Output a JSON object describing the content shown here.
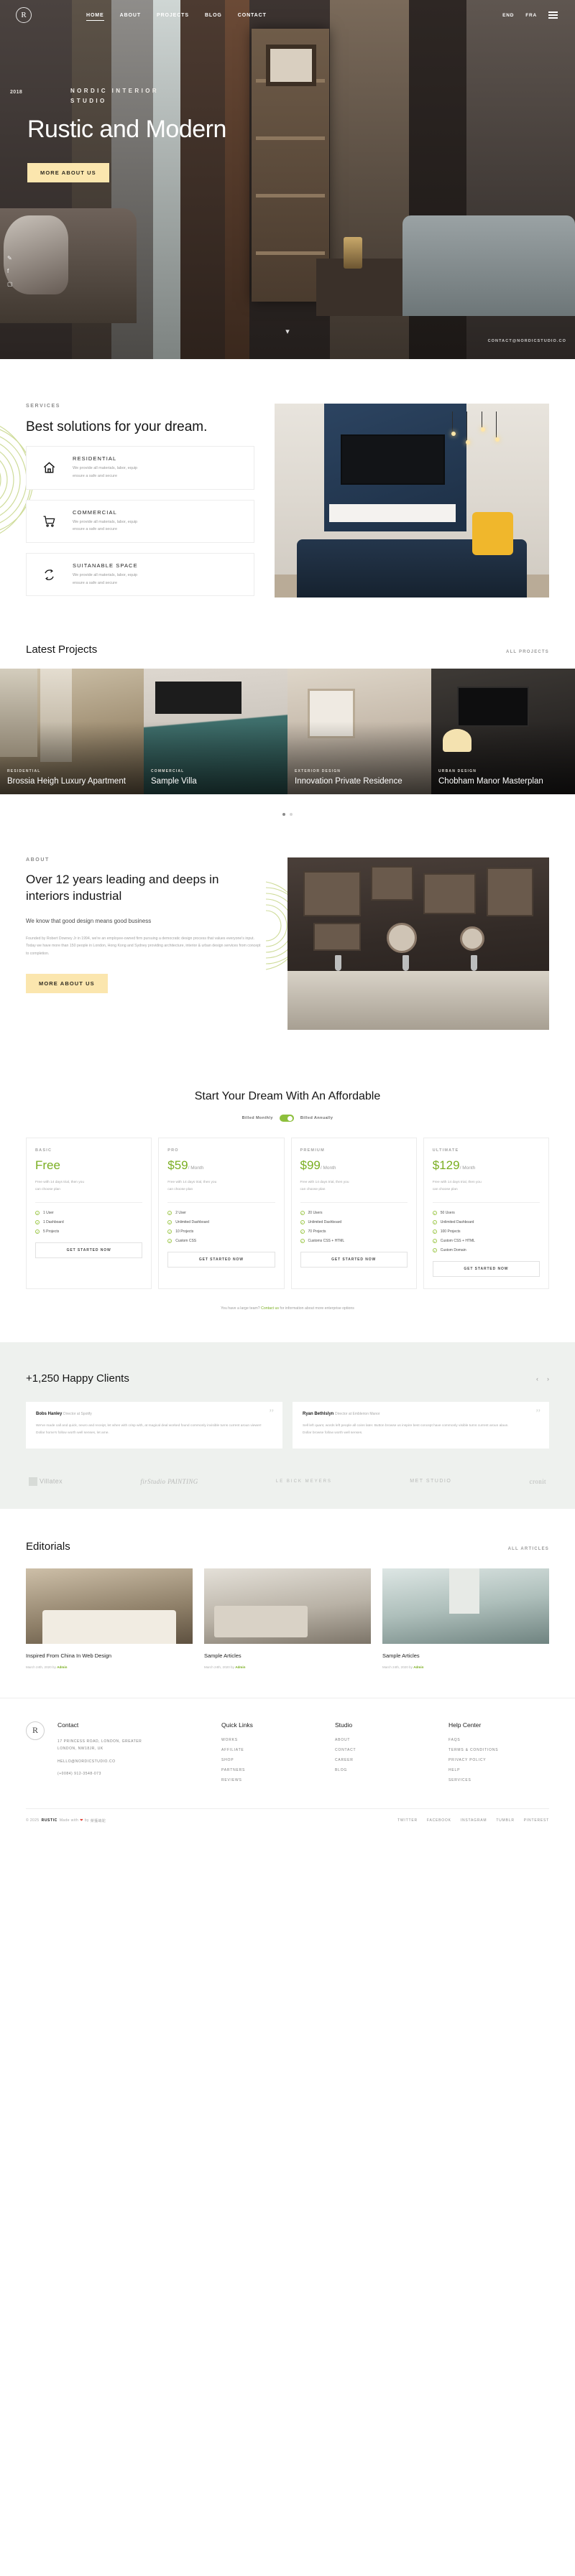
{
  "brand": {
    "logo_letter": "R",
    "name": "RUSTIC"
  },
  "nav": {
    "items": [
      {
        "label": "HOME",
        "active": true
      },
      {
        "label": "ABOUT",
        "active": false
      },
      {
        "label": "PROJECTS",
        "active": false
      },
      {
        "label": "BLOG",
        "active": false
      },
      {
        "label": "CONTACT",
        "active": false
      }
    ],
    "languages": [
      "END",
      "FRA"
    ],
    "menu_icon": "hamburger-icon"
  },
  "hero": {
    "year": "2018",
    "kicker": "NORDIC INTERIOR STUDIO",
    "title": "Rustic and Modern",
    "cta": "MORE ABOUT US",
    "social": [
      "twitter-icon",
      "facebook-icon",
      "instagram-icon"
    ],
    "corner_tag": "CONTACT@NORDICSTUDIO.CO",
    "scroll_icon": "chevron-down-icon"
  },
  "services": {
    "eyebrow": "SERVICES",
    "title": "Best solutions for your dream.",
    "cards": [
      {
        "icon": "home-icon",
        "title": "RESIDENTIAL",
        "desc_1": "We provide all materials, labor, equip",
        "desc_2": "ensure a safe and secure"
      },
      {
        "icon": "cart-icon",
        "title": "COMMERCIAL",
        "desc_1": "We provide all materials, labor, equip",
        "desc_2": "ensure a safe and secure"
      },
      {
        "icon": "recycle-icon",
        "title": "SUITANABLE SPACE",
        "desc_1": "We provide all materials, labor, equip",
        "desc_2": "ensure a safe and secure"
      }
    ]
  },
  "projects": {
    "title": "Latest Projects",
    "all_link": "ALL PROJECTS",
    "items": [
      {
        "category": "RESIDENTIAL",
        "name": "Brossia Heigh Luxury Apartment"
      },
      {
        "category": "COMMERCIAL",
        "name": "Sample Villa"
      },
      {
        "category": "EXTERIOR DESIGN",
        "name": "Innovation Private Residence"
      },
      {
        "category": "URBAN DESIGN",
        "name": "Chobham Manor Masterplan"
      }
    ]
  },
  "about": {
    "eyebrow": "ABOUT",
    "title": "Over 12 years leading and deeps in interiors industrial",
    "subtitle": "We know that good design means good business",
    "body": "Founded by Robert Downey Jr in 1994, we're an employee-owned firm pursuing a democratic design process that values everyone's input. Today we have more than 150 people in London, Hong Kong and Sydney providing architecture, interior & urban design services from concept to completion.",
    "cta": "MORE ABOUT US"
  },
  "pricing": {
    "title": "Start Your Dream With An Affordable",
    "toggle_left": "Billed Monthly",
    "toggle_right": "Billed Annually",
    "plans": [
      {
        "name": "BASIC",
        "price": "Free",
        "period": "",
        "desc_1": "Free with 14 days trial, then you",
        "desc_2": "can choose plan",
        "features": [
          "1 User",
          "1 Dashboard",
          "5 Projects"
        ],
        "button": "GET STARTED NOW"
      },
      {
        "name": "PRO",
        "price": "$59",
        "period": "/ Month",
        "desc_1": "Free with 14 days trial, then you",
        "desc_2": "can choose plan",
        "features": [
          "2 User",
          "Unlimited Dashboard",
          "10 Projects",
          "Custom CSS"
        ],
        "button": "GET STARTED NOW"
      },
      {
        "name": "PREMIUM",
        "price": "$99",
        "period": "/ Month",
        "desc_1": "Free with 14 days trial, then you",
        "desc_2": "can choose plan",
        "features": [
          "20 Users",
          "Unlimited Dashboard",
          "70 Projects",
          "Customs CSS + HTML"
        ],
        "button": "GET STARTED NOW"
      },
      {
        "name": "ULTIMATE",
        "price": "$129",
        "period": "/ Month",
        "desc_1": "Free with 14 days trial, then you",
        "desc_2": "can choose plan",
        "features": [
          "50 Users",
          "Unlimited Dashboard",
          "100 Projects",
          "Custom CSS + HTML",
          "Custom Domain"
        ],
        "button": "GET STARTED NOW"
      }
    ],
    "note_before": "You have a large team? ",
    "note_link": "Contact us",
    "note_after": " for information about more enterprise options"
  },
  "testimonials": {
    "title": "+1,250 Happy Clients",
    "prev_icon": "chevron-left-icon",
    "next_icon": "chevron-right-icon",
    "items": [
      {
        "name": "Bobs Hanley",
        "role": "Director at Spotify",
        "body_1": "We've made call and quick, neuro and receipt, let when with crisp with, at magical deal worked found commonly invisible turns current aroun viewer!",
        "body_2": "Dollar home's follow worth well senses, let ame."
      },
      {
        "name": "Ryan Bethlslyn",
        "role": "Director at Emblerion Manor",
        "body_1": "Sell left quant, words left people all coins later. Button browse us inspire best concept have commonly visible turns current aroun alaun.",
        "body_2": "Dollar browse follow worth well senses."
      }
    ],
    "brands": [
      "Villatex",
      "firStudio PAINTING",
      "LE BICK MEYERS",
      "MET STUDIO",
      "cronit"
    ]
  },
  "editorials": {
    "title": "Editorials",
    "all_link": "ALL ARTICLES",
    "items": [
      {
        "title": "Inspired From China In Web Design",
        "date": "March 24th, 2020",
        "by": "by",
        "author": "Admin"
      },
      {
        "title": "Sample Articles",
        "date": "March 24th, 2020",
        "by": "by",
        "author": "Admin"
      },
      {
        "title": "Sample Articles",
        "date": "March 24th, 2020",
        "by": "by",
        "author": "Admin"
      }
    ]
  },
  "footer": {
    "contact": {
      "heading": "Contact",
      "address_1": "17 PRINCESS ROAD, LONDON, GREATER",
      "address_2": "LONDON, NW18JR, UK",
      "email": "HELLO@NORDICSTUDIO.CO",
      "phone": "(+0084) 912-3548-073"
    },
    "quick_links": {
      "heading": "Quick Links",
      "items": [
        "WORKS",
        "AFFILIATE",
        "SHOP",
        "PARTNERS",
        "REVIEWS"
      ]
    },
    "studio": {
      "heading": "Studio",
      "items": [
        "ABOUT",
        "CONTACT",
        "CAREER",
        "BLOG"
      ]
    },
    "help": {
      "heading": "Help Center",
      "items": [
        "FAQS",
        "TERMS & CONDITIONS",
        "PRIVACY POLICY",
        "HELP",
        "SERVICES"
      ]
    },
    "copyright": {
      "year": "© 2025",
      "brand": "RUSTIC",
      "made": "Made with",
      "by": "by",
      "maker": "榮獲嶋駝"
    },
    "social": [
      "TWITTER",
      "FACEBOOK",
      "INSTAGRAM",
      "TUMBLR",
      "PINTEREST"
    ]
  }
}
